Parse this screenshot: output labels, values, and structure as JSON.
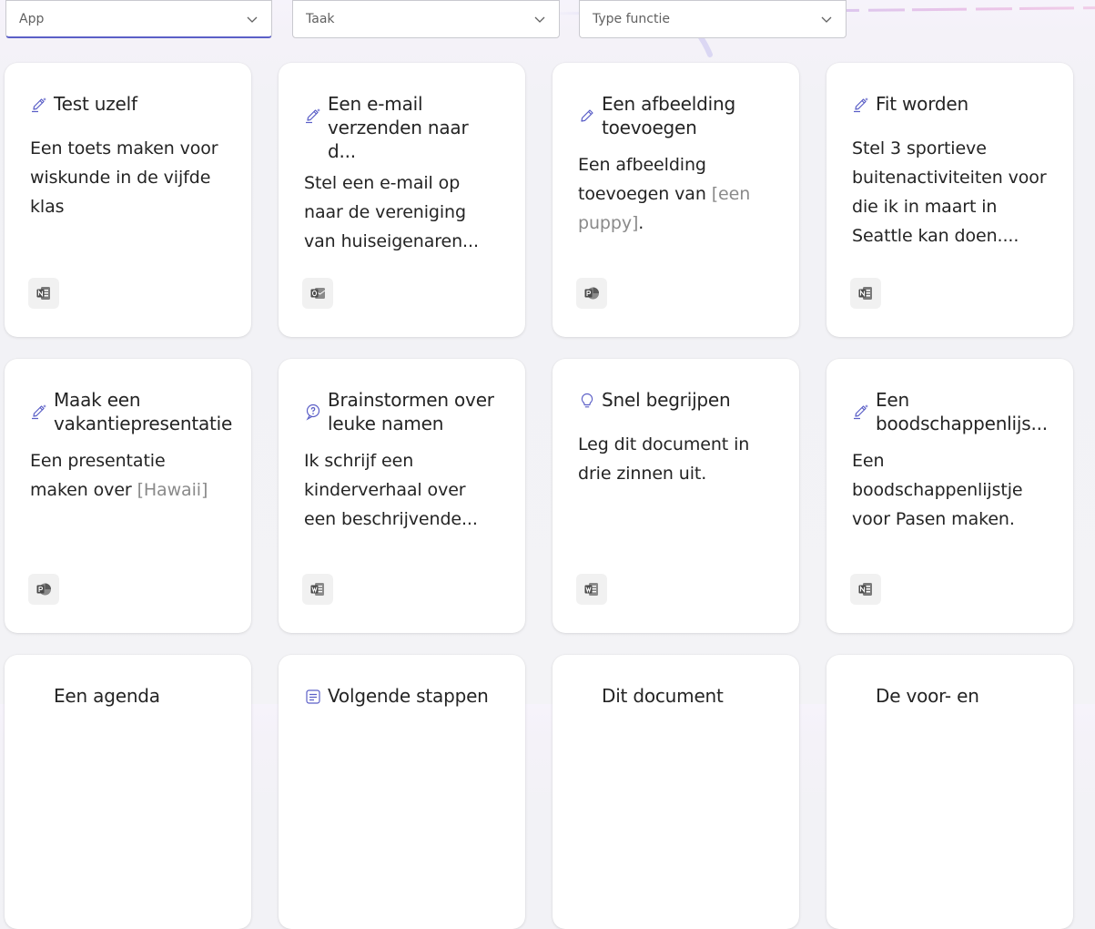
{
  "filters": [
    {
      "label": "App"
    },
    {
      "label": "Taak"
    },
    {
      "label": "Type functie"
    }
  ],
  "cards": [
    {
      "title": "Test uzelf",
      "desc": "Een toets maken voor wiskunde in de vijfde klas",
      "placeholder": "",
      "desc_after": "",
      "icon": "pen-sparkle-icon",
      "app": "onenote-icon"
    },
    {
      "title": "Een e-mail verzenden naar d...",
      "desc": "Stel een e-mail op naar de vereniging van huiseigenaren...",
      "placeholder": "",
      "desc_after": "",
      "icon": "pen-sparkle-icon",
      "app": "outlook-icon"
    },
    {
      "title": "Een afbeelding toevoegen",
      "desc": "Een afbeelding toevoegen van ",
      "placeholder": "[een puppy]",
      "desc_after": ".",
      "icon": "pen-icon",
      "app": "powerpoint-icon"
    },
    {
      "title": "Fit worden",
      "desc": "Stel 3 sportieve buitenactiviteiten voor die ik in maart in Seattle kan doen....",
      "placeholder": "",
      "desc_after": "",
      "icon": "pen-sparkle-icon",
      "app": "onenote-icon"
    },
    {
      "title": "Maak een vakantiepresentatie",
      "desc": "Een presentatie maken over ",
      "placeholder": "[Hawaii]",
      "desc_after": "",
      "icon": "pen-sparkle-icon",
      "app": "powerpoint-icon"
    },
    {
      "title": "Brainstormen over leuke namen",
      "desc": "Ik schrijf een kinderverhaal over een beschrijvende...",
      "placeholder": "",
      "desc_after": "",
      "icon": "chat-question-icon",
      "app": "word-icon"
    },
    {
      "title": "Snel begrijpen",
      "desc": "Leg dit document in drie zinnen uit.",
      "placeholder": "",
      "desc_after": "",
      "icon": "lightbulb-icon",
      "app": "word-icon"
    },
    {
      "title": "Een boodschappenlijs...",
      "desc": "Een boodschappenlijstje voor Pasen maken.",
      "placeholder": "",
      "desc_after": "",
      "icon": "pen-sparkle-icon",
      "app": "onenote-icon"
    },
    {
      "title": "Een agenda",
      "desc": "",
      "placeholder": "",
      "desc_after": "",
      "icon": "",
      "app": ""
    },
    {
      "title": "Volgende stappen",
      "desc": "",
      "placeholder": "",
      "desc_after": "",
      "icon": "list-icon",
      "app": ""
    },
    {
      "title": "Dit document",
      "desc": "",
      "placeholder": "",
      "desc_after": "",
      "icon": "",
      "app": ""
    },
    {
      "title": "De voor- en",
      "desc": "",
      "placeholder": "",
      "desc_after": "",
      "icon": "",
      "app": ""
    }
  ],
  "colors": {
    "accent": "#5b5fc7",
    "icon": "#5b5fc7",
    "placeholder": "#8a8a8a"
  }
}
